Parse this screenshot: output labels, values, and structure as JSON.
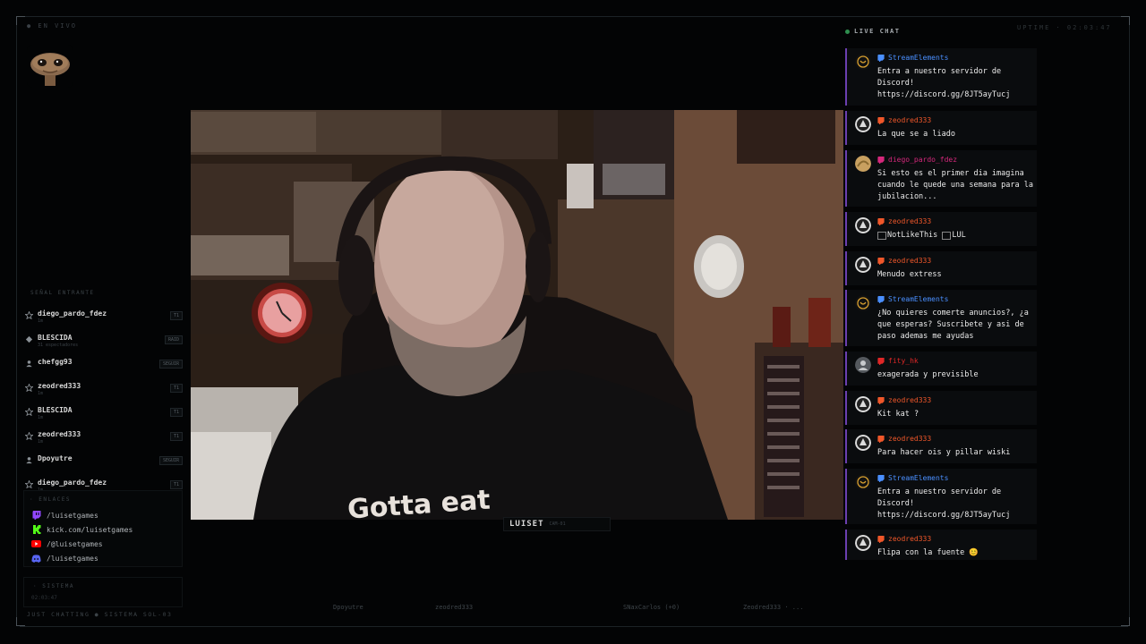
{
  "overlay": {
    "top_left_label": "● EN VIVO",
    "top_right_label": "UPTIME · 02:03:47",
    "bottom_left_label": "JUST CHATTING ● SISTEMA SOL-03"
  },
  "events": {
    "label": "SEÑAL ENTRANTE",
    "items": [
      {
        "icon": "star-icon",
        "name": "diego_pardo_fdez",
        "sub": "1m",
        "tag": "T1"
      },
      {
        "icon": "raid-icon",
        "name": "BLESCIDA",
        "sub": "31 espectadores",
        "tag": "RAID"
      },
      {
        "icon": "follow-icon",
        "name": "chefgg93",
        "sub": "",
        "tag": "SEGUIR"
      },
      {
        "icon": "star-icon",
        "name": "zeodred333",
        "sub": "1m",
        "tag": "T1"
      },
      {
        "icon": "star-icon",
        "name": "BLESCIDA",
        "sub": "1m",
        "tag": "T1"
      },
      {
        "icon": "star-icon",
        "name": "zeodred333",
        "sub": "1m",
        "tag": "T1"
      },
      {
        "icon": "follow-icon",
        "name": "Dpoyutre",
        "sub": "",
        "tag": "SEGUIR"
      },
      {
        "icon": "star-icon",
        "name": "diego_pardo_fdez",
        "sub": "1m",
        "tag": "T1"
      }
    ]
  },
  "links": {
    "label": "ENLACES",
    "items": [
      {
        "icon": "twitch-icon",
        "text": "/luisetgames",
        "color": "#9146ff"
      },
      {
        "icon": "kick-icon",
        "text": "kick.com/luisetgames",
        "color": "#53fc18"
      },
      {
        "icon": "youtube-icon",
        "text": "/@luisetgames",
        "color": "#ff0000"
      },
      {
        "icon": "discord-icon",
        "text": "/luisetgames",
        "color": "#5865f2"
      }
    ]
  },
  "system": {
    "label": "SISTEMA",
    "value": "02:03:47"
  },
  "camera": {
    "name": "LUISET",
    "ext": "CAM-01",
    "shirt_text": "Gotta eat"
  },
  "ticker": [
    "Dpoyutre",
    "zeodred333",
    "SNaxCarlos (+0)",
    "Zeodred333 · ..."
  ],
  "chat": {
    "title": "LIVE CHAT",
    "messages": [
      {
        "user": "StreamElements",
        "color": "#4a8fff",
        "avatar": "bot",
        "text": "Entra a nuestro servidor de Discord! https://discord.gg/8JT5ayTucj"
      },
      {
        "user": "zeodred333",
        "color": "#f0572a",
        "avatar": "user",
        "text": "La que se a liado"
      },
      {
        "user": "diego_pardo_fdez",
        "color": "#d6287c",
        "avatar": "gold",
        "text": "Si esto es el primer dia imagina cuando le quede una semana para la jubilacion..."
      },
      {
        "user": "zeodred333",
        "color": "#f0572a",
        "avatar": "user",
        "emotes": [
          "NotLikeThis",
          "LUL"
        ]
      },
      {
        "user": "zeodred333",
        "color": "#f0572a",
        "avatar": "user",
        "text": "Menudo extress"
      },
      {
        "user": "StreamElements",
        "color": "#4a8fff",
        "avatar": "bot",
        "text": "¿No quieres comerte anuncios?, ¿a que esperas? Suscribete y asi de paso ademas me ayudas"
      },
      {
        "user": "fity_hk",
        "color": "#e02727",
        "avatar": "default",
        "text": "exagerada y previsible"
      },
      {
        "user": "zeodred333",
        "color": "#f0572a",
        "avatar": "user",
        "text": "Kit kat ?"
      },
      {
        "user": "zeodred333",
        "color": "#f0572a",
        "avatar": "user",
        "text": "Para hacer ois y pillar wiski"
      },
      {
        "user": "StreamElements",
        "color": "#4a8fff",
        "avatar": "bot",
        "text": "Entra a nuestro servidor de Discord! https://discord.gg/8JT5ayTucj"
      },
      {
        "user": "zeodred333",
        "color": "#f0572a",
        "avatar": "user",
        "text": "Flipa con la fuente 😊"
      }
    ]
  }
}
